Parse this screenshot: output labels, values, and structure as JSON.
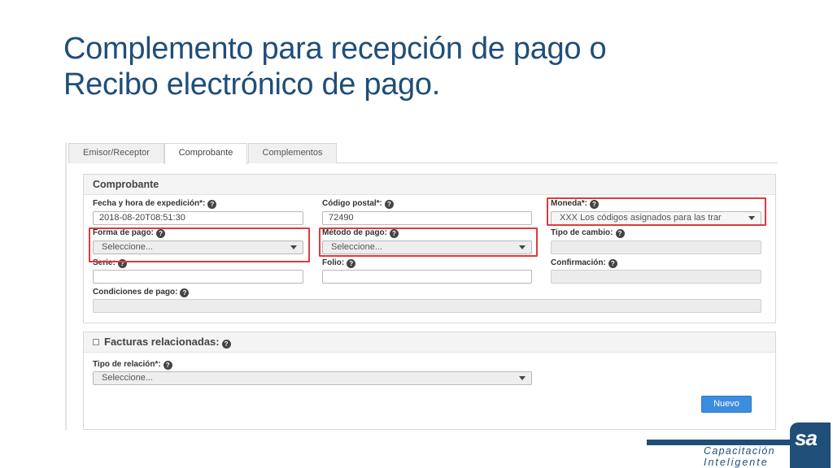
{
  "slide": {
    "title_line1": "Complemento para recepción de pago o",
    "title_line2": "Recibo electrónico de pago."
  },
  "tabs": [
    {
      "label": "Emisor/Receptor",
      "active": false
    },
    {
      "label": "Comprobante",
      "active": true
    },
    {
      "label": "Complementos",
      "active": false
    }
  ],
  "comprobante": {
    "header": "Comprobante",
    "fecha_label": "Fecha y hora de expedición*:",
    "fecha_value": "2018-08-20T08:51:30",
    "cp_label": "Código postal*:",
    "cp_value": "72490",
    "moneda_label": "Moneda*:",
    "moneda_value": "XXX Los códigos asignados para las trar",
    "forma_label": "Forma de pago:",
    "forma_value": "Seleccione...",
    "metodo_label": "Método de pago:",
    "metodo_value": "Seleccione...",
    "tipo_cambio_label": "Tipo de cambio:",
    "serie_label": "Serie:",
    "folio_label": "Folio:",
    "confirmacion_label": "Confirmación:",
    "condiciones_label": "Condiciones de pago:",
    "help_glyph": "?"
  },
  "facturas": {
    "header": "Facturas relacionadas:",
    "tipo_relacion_label": "Tipo de relación*:",
    "tipo_relacion_value": "Seleccione...",
    "nuevo_button": "Nuevo"
  },
  "logo": {
    "brand_sa": "sa",
    "tagline_1": "Capacitación",
    "tagline_2": "Inteligente",
    "registered": "®"
  },
  "colors": {
    "title": "#1f4e79",
    "highlight": "#e03a3a",
    "button": "#3c8dde"
  }
}
